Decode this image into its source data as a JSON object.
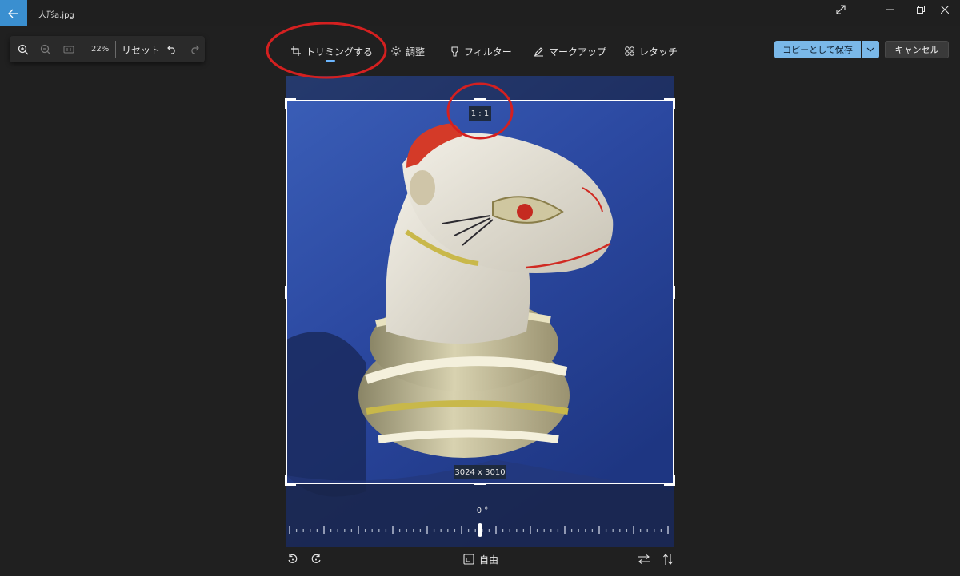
{
  "window": {
    "title": "人形a.jpg"
  },
  "zoom": {
    "percent": "22%",
    "reset_label": "リセット"
  },
  "tabs": [
    {
      "label": "トリミングする",
      "active": true
    },
    {
      "label": "調整",
      "active": false
    },
    {
      "label": "フィルター",
      "active": false
    },
    {
      "label": "マークアップ",
      "active": false
    },
    {
      "label": "レタッチ",
      "active": false
    }
  ],
  "actions": {
    "save_label": "コピーとして保存",
    "cancel_label": "キャンセル"
  },
  "crop": {
    "aspect_ratio": "1 : 1",
    "dimensions": "3024 x 3010",
    "angle": "0 °",
    "aspect_mode_label": "自由"
  },
  "colors": {
    "accent": "#6cb6ff",
    "primary_button": "#7ab8e8",
    "back_button": "#3a8fd0",
    "annotation_red": "#d42020"
  },
  "icons": [
    "back-arrow-icon",
    "expand-icon",
    "minimize-icon",
    "restore-icon",
    "close-icon",
    "zoom-in-icon",
    "zoom-out-icon",
    "fit-screen-icon",
    "undo-icon",
    "redo-icon",
    "crop-icon",
    "brightness-icon",
    "filter-icon",
    "markup-pen-icon",
    "retouch-icon",
    "chevron-down-icon",
    "rotate-left-icon",
    "rotate-right-icon",
    "aspect-ratio-icon",
    "flip-horizontal-icon",
    "flip-vertical-icon"
  ]
}
